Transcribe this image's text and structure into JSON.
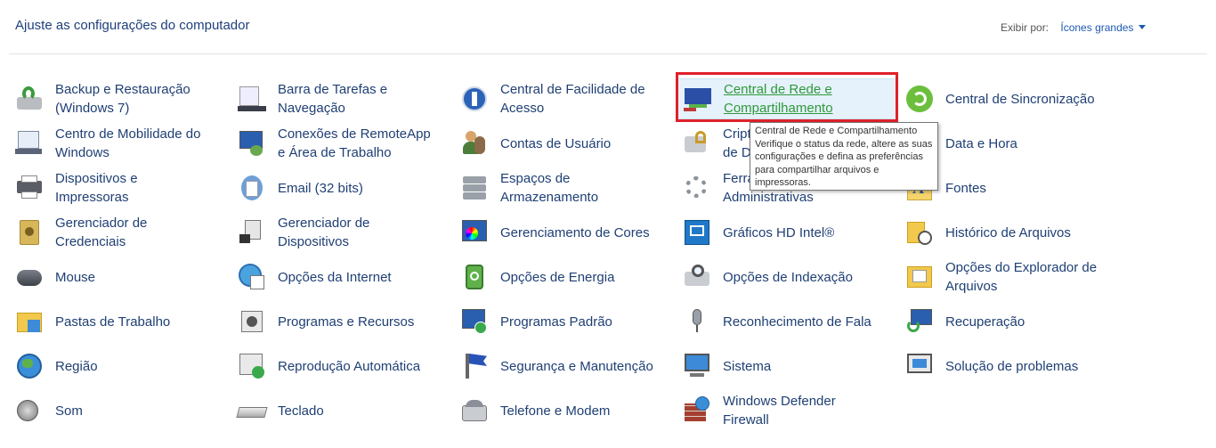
{
  "header": {
    "title": "Ajuste as configurações do computador",
    "view_by_label": "Exibir por:",
    "view_by_value": "Ícones grandes"
  },
  "items": [
    {
      "label": "Backup e Restauração (Windows 7)",
      "icon": "backup-restore-icon"
    },
    {
      "label": "Barra de Tarefas e Navegação",
      "icon": "taskbar-icon"
    },
    {
      "label": "Central de Facilidade de Acesso",
      "icon": "ease-of-access-icon"
    },
    {
      "label": "Central de Rede e Compartilhamento",
      "icon": "network-sharing-icon"
    },
    {
      "label": "Central de Sincronização",
      "icon": "sync-center-icon"
    },
    {
      "label": "Centro de Mobilidade do Windows",
      "icon": "mobility-center-icon"
    },
    {
      "label": "Conexões de RemoteApp e Área de Trabalho",
      "icon": "remoteapp-icon"
    },
    {
      "label": "Contas de Usuário",
      "icon": "user-accounts-icon"
    },
    {
      "label": "Criptografia de Unidade de Disco BitLocker",
      "icon": "bitlocker-icon"
    },
    {
      "label": "Data e Hora",
      "icon": "date-time-icon"
    },
    {
      "label": "Dispositivos e Impressoras",
      "icon": "devices-printers-icon"
    },
    {
      "label": "Email (32 bits)",
      "icon": "mail-icon"
    },
    {
      "label": "Espaços de Armazenamento",
      "icon": "storage-spaces-icon"
    },
    {
      "label": "Ferramentas Administrativas",
      "icon": "admin-tools-icon"
    },
    {
      "label": "Fontes",
      "icon": "fonts-icon"
    },
    {
      "label": "Gerenciador de Credenciais",
      "icon": "credential-manager-icon"
    },
    {
      "label": "Gerenciador de Dispositivos",
      "icon": "device-manager-icon"
    },
    {
      "label": "Gerenciamento de Cores",
      "icon": "color-management-icon"
    },
    {
      "label": "Gráficos HD Intel®",
      "icon": "intel-graphics-icon"
    },
    {
      "label": "Histórico de Arquivos",
      "icon": "file-history-icon"
    },
    {
      "label": "Mouse",
      "icon": "mouse-icon"
    },
    {
      "label": "Opções da Internet",
      "icon": "internet-options-icon"
    },
    {
      "label": "Opções de Energia",
      "icon": "power-options-icon"
    },
    {
      "label": "Opções de Indexação",
      "icon": "indexing-options-icon"
    },
    {
      "label": "Opções do Explorador de Arquivos",
      "icon": "explorer-options-icon"
    },
    {
      "label": "Pastas de Trabalho",
      "icon": "work-folders-icon"
    },
    {
      "label": "Programas e Recursos",
      "icon": "programs-features-icon"
    },
    {
      "label": "Programas Padrão",
      "icon": "default-programs-icon"
    },
    {
      "label": "Reconhecimento de Fala",
      "icon": "speech-recognition-icon"
    },
    {
      "label": "Recuperação",
      "icon": "recovery-icon"
    },
    {
      "label": "Região",
      "icon": "region-icon"
    },
    {
      "label": "Reprodução Automática",
      "icon": "autoplay-icon"
    },
    {
      "label": "Segurança e Manutenção",
      "icon": "security-maintenance-icon"
    },
    {
      "label": "Sistema",
      "icon": "system-icon"
    },
    {
      "label": "Solução de problemas",
      "icon": "troubleshooting-icon"
    },
    {
      "label": "Som",
      "icon": "sound-icon"
    },
    {
      "label": "Teclado",
      "icon": "keyboard-icon"
    },
    {
      "label": "Telefone e Modem",
      "icon": "phone-modem-icon"
    },
    {
      "label": "Windows Defender Firewall",
      "icon": "firewall-icon"
    }
  ],
  "tooltip": {
    "title": "Central de Rede e Compartilhamento",
    "body": "Verifique o status da rede, altere as suas configurações e defina as preferências para compartilhar arquivos e impressoras."
  },
  "colors": {
    "link": "#1f3f74",
    "highlight_border": "#e0202a",
    "hover_text": "#2f9a3a"
  }
}
